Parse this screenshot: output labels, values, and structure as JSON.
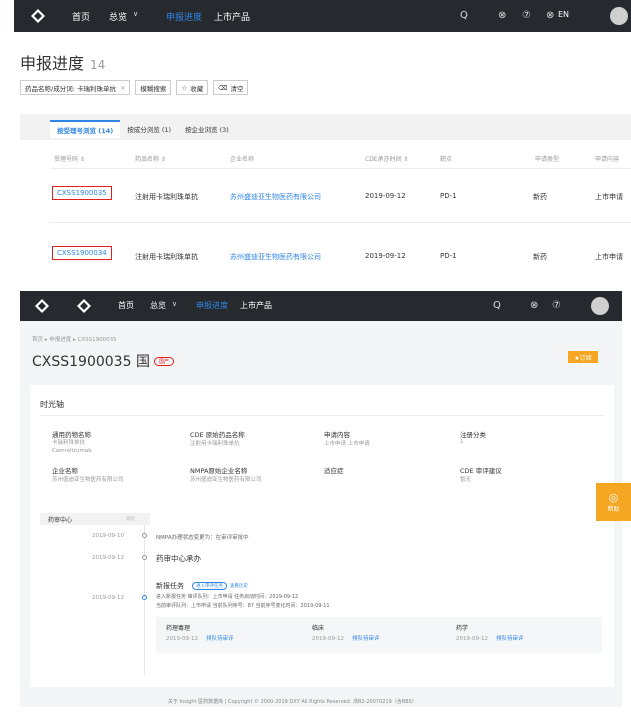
{
  "colors": {
    "nav_bg": "#26292e",
    "accent": "#2f86e6",
    "highlight": "#e02020",
    "gold": "#f5a623"
  },
  "nav": {
    "home": "首页",
    "overview": "总览",
    "overview_chevron": "∨",
    "progress": "申报进度",
    "market": "上市产品",
    "search_icon": "Q",
    "lang_icon": "⊗",
    "help_icon": "⑦",
    "lang": "EN"
  },
  "list": {
    "title": "申报进度",
    "count": "14",
    "filter_chip": "药品名称/成分词: 卡瑞利珠单抗",
    "filter_close": "×",
    "fuzzy_button": "模糊搜索",
    "star_icon": "☆",
    "collect_button": "收藏",
    "trash_icon": "⌫",
    "clear_button": "清空",
    "tabs": [
      "按受理号浏览 (14)",
      "按成分浏览 (1)",
      "按企业浏览 (3)"
    ],
    "columns": [
      "受理号码 ⇕",
      "药品名称 ⇕",
      "企业名称",
      "CDE承办时间 ⇕",
      "靶点",
      "申请类型",
      "申请内容"
    ],
    "rows": [
      {
        "acc": "CXSS1900035",
        "drug": "注射用卡瑞利珠单抗",
        "company": "苏州盛迪亚生物医药有限公司",
        "date": "2019-09-12",
        "target": "PD-1",
        "type": "新药",
        "content": "上市申请"
      },
      {
        "acc": "CXSS1900034",
        "drug": "注射用卡瑞利珠单抗",
        "company": "苏州盛迪亚生物医药有限公司",
        "date": "2019-09-12",
        "target": "PD-1",
        "type": "新药",
        "content": "上市申请"
      }
    ]
  },
  "detail": {
    "breadcrumb": "首页 ▸ 申报进度 ▸ CXSS1900035",
    "title": "CXSS1900035 国",
    "badge": "国产",
    "subscribe": "★订阅",
    "section": "时光轴",
    "info": [
      {
        "label": "通用药物名称",
        "value": "卡瑞利珠单抗\nCamrelizumab"
      },
      {
        "label": "CDE 原始药品名称",
        "value": "注射用卡瑞利珠单抗"
      },
      {
        "label": "申请内容",
        "value": "上市申请 上市申请"
      },
      {
        "label": "注册分类",
        "value": "1"
      },
      {
        "label": "企业名称",
        "value": "苏州盛迪亚生物医药有限公司"
      },
      {
        "label": "NMPA原始企业名称",
        "value": "苏州盛迪亚生物医药有限公司"
      },
      {
        "label": "适应症",
        "value": ""
      },
      {
        "label": "CDE 审评建议",
        "value": "暂无"
      }
    ],
    "side_label": "药审中心",
    "side_collapse": "收起",
    "timeline": [
      {
        "date": "2019-09-10",
        "text": "NMPA办理状态变更为：在审评审批中"
      },
      {
        "date": "2019-09-12",
        "text": "药审中心承办"
      }
    ],
    "task_title": "新报任务",
    "task_tag": "进入审评任务",
    "task_history": "查看历史",
    "task_date": "2019-09-12",
    "task_line1": "进入新报任务  审评队列：上市申请  任务启动时间：2019-09-12",
    "task_line2": "当前审评队列：上市申请  当前队列序号：87  当前序号变化时间：2019-09-11",
    "sub": [
      {
        "label": "药理毒理",
        "date": "2019-09-12",
        "status": "排队待审评"
      },
      {
        "label": "临床",
        "date": "2019-09-12",
        "status": "排队待审评"
      },
      {
        "label": "药学",
        "date": "2019-09-12",
        "status": "排队待审评"
      }
    ],
    "help": "帮助",
    "footer": "关于 Insight 医药数据库 | Copyright © 2000-2019 DXY All Rights Reserved. 浙B2-20070219（含BBS）"
  }
}
